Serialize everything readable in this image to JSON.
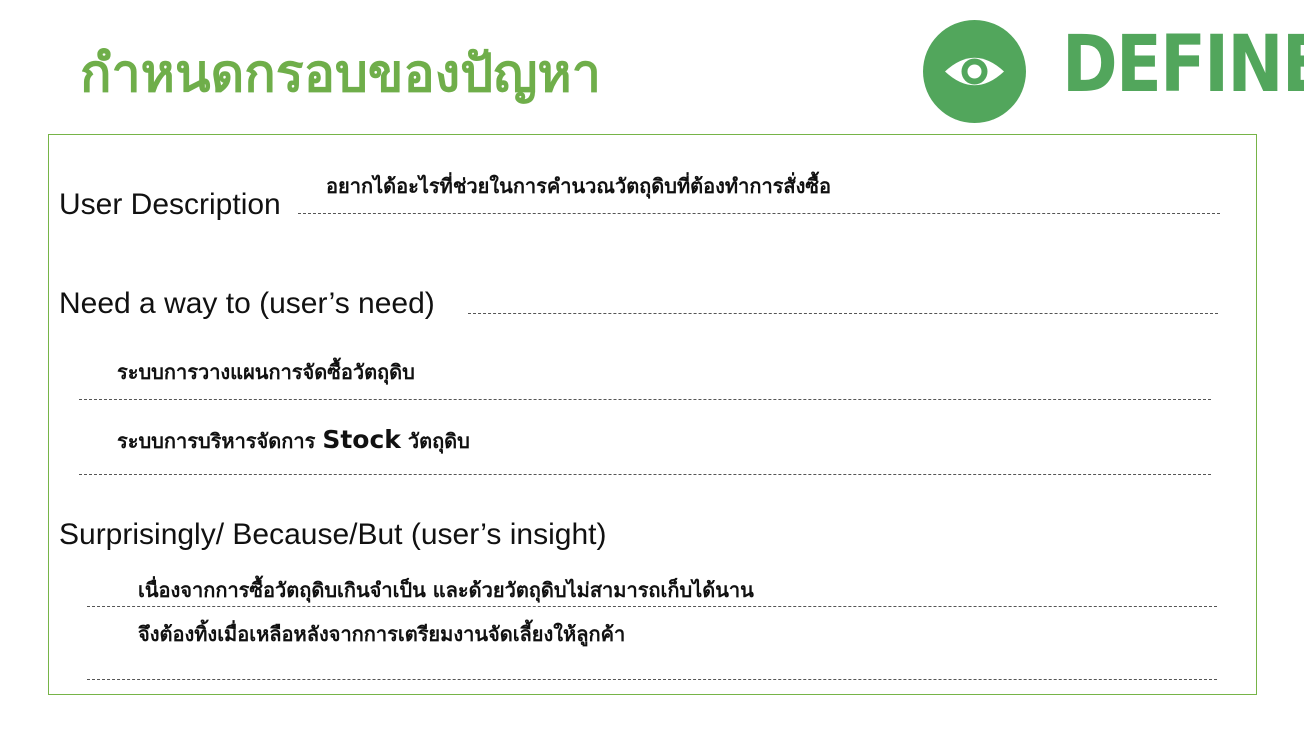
{
  "page": {
    "title": "กำหนดกรอบของปัญหา",
    "badge": {
      "icon": "eye-icon",
      "label": "DEFINE",
      "color": "#52a65c"
    }
  },
  "sections": {
    "user_description": {
      "heading": "User Description",
      "answer": "อยากได้อะไรที่ช่วยในการคำนวณวัตถุดิบที่ต้องทำการสั่งซื้อ"
    },
    "need": {
      "heading": "Need a way to (user’s need)",
      "items": [
        {
          "text": "ระบบการวางแผนการจัดซื้อวัตถุดิบ"
        },
        {
          "prefix": "ระบบการบริหารจัดการ ",
          "highlight": "Stock",
          "suffix": " วัตถุดิบ"
        }
      ]
    },
    "insight": {
      "heading": "Surprisingly/ Because/But (user’s insight)",
      "lines": [
        "เนื่องจากการซื้อวัตถุดิบเกินจำเป็น และด้วยวัตถุดิบไม่สามารถเก็บได้นาน",
        "จึงต้องทิ้งเมื่อเหลือหลังจากการเตรียมงานจัดเลี้ยงให้ลูกค้า"
      ]
    }
  },
  "colors": {
    "title": "#6fae4a",
    "frame": "#76b447",
    "accent": "#52a65c",
    "text": "#111111"
  }
}
